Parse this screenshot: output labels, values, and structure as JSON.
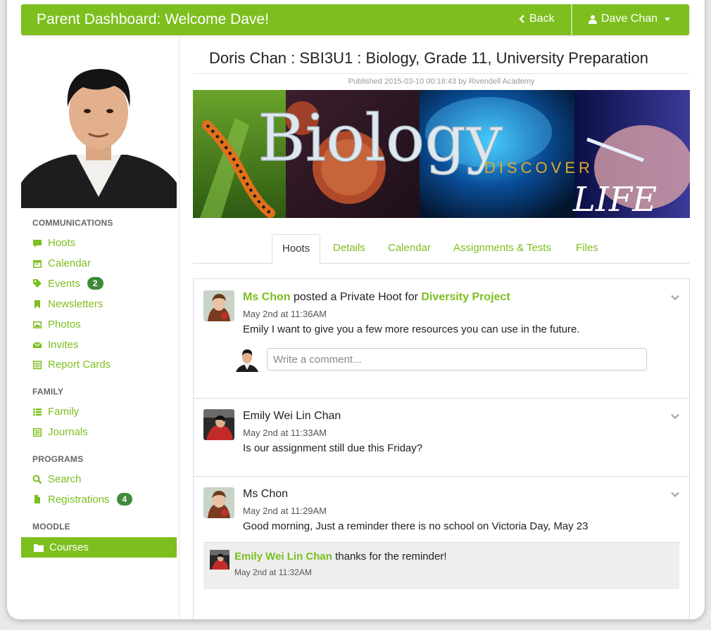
{
  "header": {
    "title": "Parent Dashboard: Welcome Dave!",
    "back_label": "Back",
    "user_label": "Dave Chan"
  },
  "sidebar": {
    "sections": [
      {
        "heading": "COMMUNICATIONS"
      },
      {
        "heading": "FAMILY"
      },
      {
        "heading": "PROGRAMS"
      },
      {
        "heading": "MOODLE"
      }
    ],
    "items": [
      {
        "label": "Hoots",
        "icon": "comment-icon"
      },
      {
        "label": "Calendar",
        "icon": "calendar-icon"
      },
      {
        "label": "Events",
        "icon": "tags-icon",
        "badge": "2"
      },
      {
        "label": "Newsletters",
        "icon": "bookmark-icon"
      },
      {
        "label": "Photos",
        "icon": "picture-icon"
      },
      {
        "label": "Invites",
        "icon": "envelope-icon"
      },
      {
        "label": "Report Cards",
        "icon": "list-alt-icon"
      },
      {
        "label": "Family",
        "icon": "th-list-icon"
      },
      {
        "label": "Journals",
        "icon": "list-alt-icon"
      },
      {
        "label": "Search",
        "icon": "search-icon"
      },
      {
        "label": "Registrations",
        "icon": "file-icon",
        "badge": "4"
      },
      {
        "label": "Courses",
        "icon": "folder-icon"
      }
    ]
  },
  "course": {
    "title": "Doris Chan : SBI3U1 : Biology, Grade 11, University Preparation",
    "published": "Published 2015-03-10 00:18:43 by Rivendell Academy",
    "banner": {
      "word": "Biology",
      "discover": "DISCOVER",
      "life": "LIFE"
    }
  },
  "tabs": [
    {
      "label": "Hoots",
      "active": true
    },
    {
      "label": "Details"
    },
    {
      "label": "Calendar"
    },
    {
      "label": "Assignments & Tests"
    },
    {
      "label": "Files"
    }
  ],
  "feed": {
    "posts": [
      {
        "author": "Ms Chon",
        "action": " posted a Private Hoot for ",
        "target": "Diversity Project",
        "time": "May 2nd at 11:36AM",
        "body": "Emily I want to give you a few more resources you can use in the future.",
        "comment_placeholder": "Write a comment..."
      },
      {
        "author": "Emily Wei Lin Chan",
        "time": "May 2nd at 11:33AM",
        "body": "Is our assignment still due this Friday?"
      },
      {
        "author": "Ms Chon",
        "time": "May 2nd at 11:29AM",
        "body": "Good morning, Just a reminder there is no school on Victoria Day, May 23",
        "reply": {
          "author": "Emily Wei Lin Chan",
          "text": " thanks for the reminder!",
          "time": "May 2nd at 11:32AM"
        }
      }
    ]
  },
  "colors": {
    "accent": "#7cbf1e",
    "badge": "#3e8a3a"
  }
}
